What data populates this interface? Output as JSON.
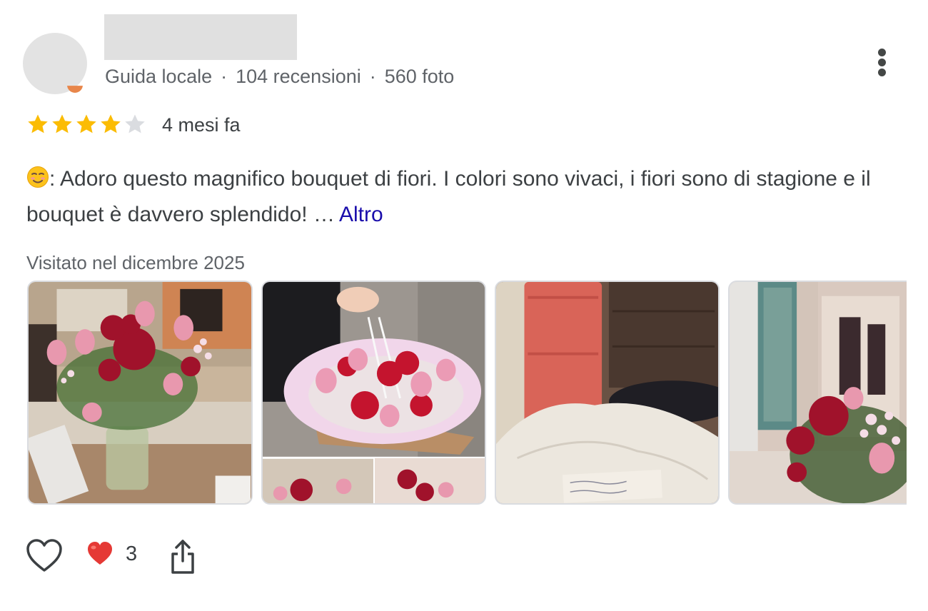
{
  "reviewer": {
    "meta_guide": "Guida locale",
    "meta_reviews": "104 recensioni",
    "meta_photos": "560 foto",
    "separator": "·"
  },
  "rating": {
    "value": 4,
    "max": 5,
    "filled_color": "#fbbc04",
    "empty_color": "#dadce0"
  },
  "time_ago": "4 mesi fa",
  "review": {
    "emoji": "smiling-face-emoji",
    "text": ": Adoro questo magnifico bouquet di fiori. I colori sono vivaci, i fiori sono di stagione e il bouquet è davvero splendido! …",
    "more_link": "Altro"
  },
  "visited": "Visitato nel dicembre 2025",
  "photos": [
    {
      "name": "bouquet-in-vase-photo"
    },
    {
      "name": "bouquet-in-bag-photo"
    },
    {
      "name": "hotel-room-bed-photo"
    },
    {
      "name": "bouquet-window-photo"
    }
  ],
  "actions": {
    "like_icon": "heart-outline-icon",
    "reaction_icon": "red-heart-emoji",
    "reaction_count": "3",
    "share_icon": "share-icon"
  },
  "colors": {
    "link": "#1a0dab",
    "text": "#3c4043",
    "secondary": "#5f6368"
  }
}
